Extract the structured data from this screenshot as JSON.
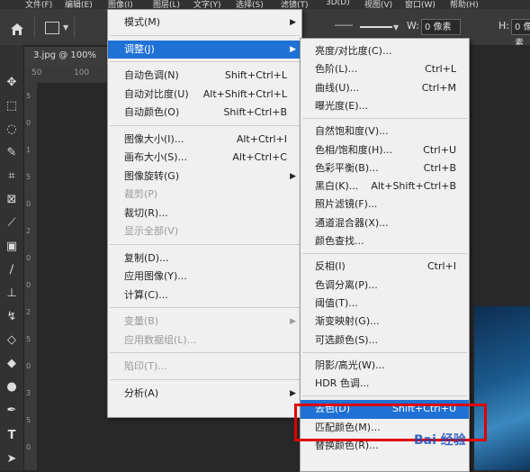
{
  "menubar": [
    "文件(F)",
    "编辑(E)",
    "图像(I)",
    "图层(L)",
    "文字(Y)",
    "选择(S)",
    "滤镜(T)",
    "3D(D)",
    "视图(V)",
    "窗口(W)",
    "帮助(H)"
  ],
  "options": {
    "w_label": "W:",
    "w_value": "0 像素",
    "h_label": "H:",
    "h_value": "0 像素"
  },
  "document_tab": "3.jpg @ 100%",
  "ruler_marks": [
    "50",
    "100"
  ],
  "vruler_marks": [
    "5",
    "0",
    "1",
    "5",
    "0",
    "2",
    "0",
    "0",
    "2",
    "5",
    "0",
    "3",
    "5",
    "0"
  ],
  "image_menu": [
    {
      "label": "模式(M)",
      "submenu": true
    },
    {
      "sep": true
    },
    {
      "label": "调整(J)",
      "submenu": true,
      "highlight": true
    },
    {
      "sep": true
    },
    {
      "label": "自动色调(N)",
      "shortcut": "Shift+Ctrl+L"
    },
    {
      "label": "自动对比度(U)",
      "shortcut": "Alt+Shift+Ctrl+L"
    },
    {
      "label": "自动颜色(O)",
      "shortcut": "Shift+Ctrl+B"
    },
    {
      "sep": true
    },
    {
      "label": "图像大小(I)...",
      "shortcut": "Alt+Ctrl+I"
    },
    {
      "label": "画布大小(S)...",
      "shortcut": "Alt+Ctrl+C"
    },
    {
      "label": "图像旋转(G)",
      "submenu": true
    },
    {
      "label": "裁剪(P)",
      "disabled": true
    },
    {
      "label": "裁切(R)..."
    },
    {
      "label": "显示全部(V)",
      "disabled": true
    },
    {
      "sep": true
    },
    {
      "label": "复制(D)..."
    },
    {
      "label": "应用图像(Y)..."
    },
    {
      "label": "计算(C)..."
    },
    {
      "sep": true
    },
    {
      "label": "变量(B)",
      "submenu": true,
      "disabled": true
    },
    {
      "label": "应用数据组(L)...",
      "disabled": true
    },
    {
      "sep": true
    },
    {
      "label": "陷印(T)...",
      "disabled": true
    },
    {
      "sep": true
    },
    {
      "label": "分析(A)",
      "submenu": true
    }
  ],
  "adjust_menu": [
    {
      "label": "亮度/对比度(C)..."
    },
    {
      "label": "色阶(L)...",
      "shortcut": "Ctrl+L"
    },
    {
      "label": "曲线(U)...",
      "shortcut": "Ctrl+M"
    },
    {
      "label": "曝光度(E)..."
    },
    {
      "sep": true
    },
    {
      "label": "自然饱和度(V)..."
    },
    {
      "label": "色相/饱和度(H)...",
      "shortcut": "Ctrl+U"
    },
    {
      "label": "色彩平衡(B)...",
      "shortcut": "Ctrl+B"
    },
    {
      "label": "黑白(K)...",
      "shortcut": "Alt+Shift+Ctrl+B"
    },
    {
      "label": "照片滤镜(F)..."
    },
    {
      "label": "通道混合器(X)..."
    },
    {
      "label": "颜色查找..."
    },
    {
      "sep": true
    },
    {
      "label": "反相(I)",
      "shortcut": "Ctrl+I"
    },
    {
      "label": "色调分离(P)..."
    },
    {
      "label": "阈值(T)..."
    },
    {
      "label": "渐变映射(G)..."
    },
    {
      "label": "可选颜色(S)..."
    },
    {
      "sep": true
    },
    {
      "label": "阴影/高光(W)..."
    },
    {
      "label": "HDR 色调..."
    },
    {
      "sep": true
    },
    {
      "label": "去色(D)",
      "shortcut": "Shift+Ctrl+U",
      "highlight": true
    },
    {
      "label": "匹配颜色(M)..."
    },
    {
      "label": "替换颜色(R)..."
    }
  ],
  "watermark": "Bai 经验",
  "colors": {
    "highlight": "#1f71d5",
    "red_box": "#e00000"
  }
}
